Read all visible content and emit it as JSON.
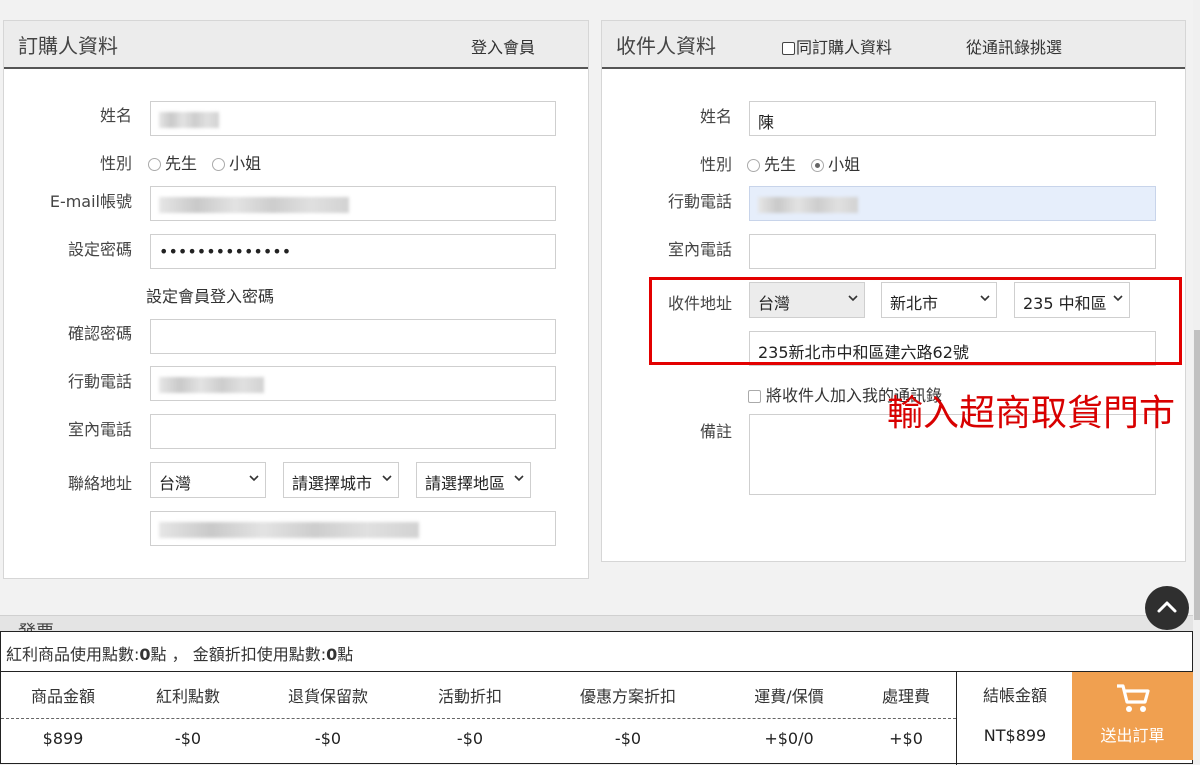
{
  "orderer": {
    "title": "訂購人資料",
    "login_link": "登入會員",
    "name_label": "姓名",
    "gender_label": "性別",
    "gender_options": [
      "先生",
      "小姐"
    ],
    "email_label": "E-mail帳號",
    "password_label": "設定密碼",
    "password_value": "••••••••••••••",
    "password_hint": "設定會員登入密碼",
    "confirm_label": "確認密碼",
    "mobile_label": "行動電話",
    "phone_label": "室內電話",
    "address_label": "聯絡地址",
    "country": "台灣",
    "city": "請選擇城市",
    "district": "請選擇地區"
  },
  "recipient": {
    "title": "收件人資料",
    "same_as_orderer": "同訂購人資料",
    "from_contacts": "從通訊錄挑選",
    "name_label": "姓名",
    "name_value": "陳",
    "gender_label": "性別",
    "gender_options": [
      "先生",
      "小姐"
    ],
    "gender_selected": "小姐",
    "mobile_label": "行動電話",
    "phone_label": "室內電話",
    "address_label": "收件地址",
    "country": "台灣",
    "city": "新北市",
    "district": "235 中和區",
    "address_value": "235新北市中和區建六路62號",
    "add_contact": "將收件人加入我的通訊錄",
    "note_label": "備註"
  },
  "annotation": "輸入超商取貨門市",
  "invoice_heading": "發票",
  "summary": {
    "points_text_1": "紅利商品使用點數:",
    "points_val_1": "0",
    "points_unit_1": "點",
    "separator": " ， ",
    "points_text_2": "金額折扣使用點數:",
    "points_val_2": "0",
    "points_unit_2": "點",
    "columns": [
      {
        "head": "商品金額",
        "value": "$899"
      },
      {
        "head": "紅利點數",
        "value": "-$0"
      },
      {
        "head": "退貨保留款",
        "value": "-$0"
      },
      {
        "head": "活動折扣",
        "value": "-$0"
      },
      {
        "head": "優惠方案折扣",
        "value": "-$0"
      },
      {
        "head": "運費/保價",
        "value": "+$0/0"
      },
      {
        "head": "處理費",
        "value": "+$0"
      }
    ],
    "total_head": "結帳金額",
    "total_value": "NT$899",
    "submit_label": "送出訂單"
  },
  "colors": {
    "accent_orange": "#f0a050",
    "annotation_red": "#e30000",
    "highlight_blue": "#e6eefb"
  },
  "icons": [
    "chevron-down-icon",
    "cart-icon",
    "arrow-up-icon"
  ]
}
